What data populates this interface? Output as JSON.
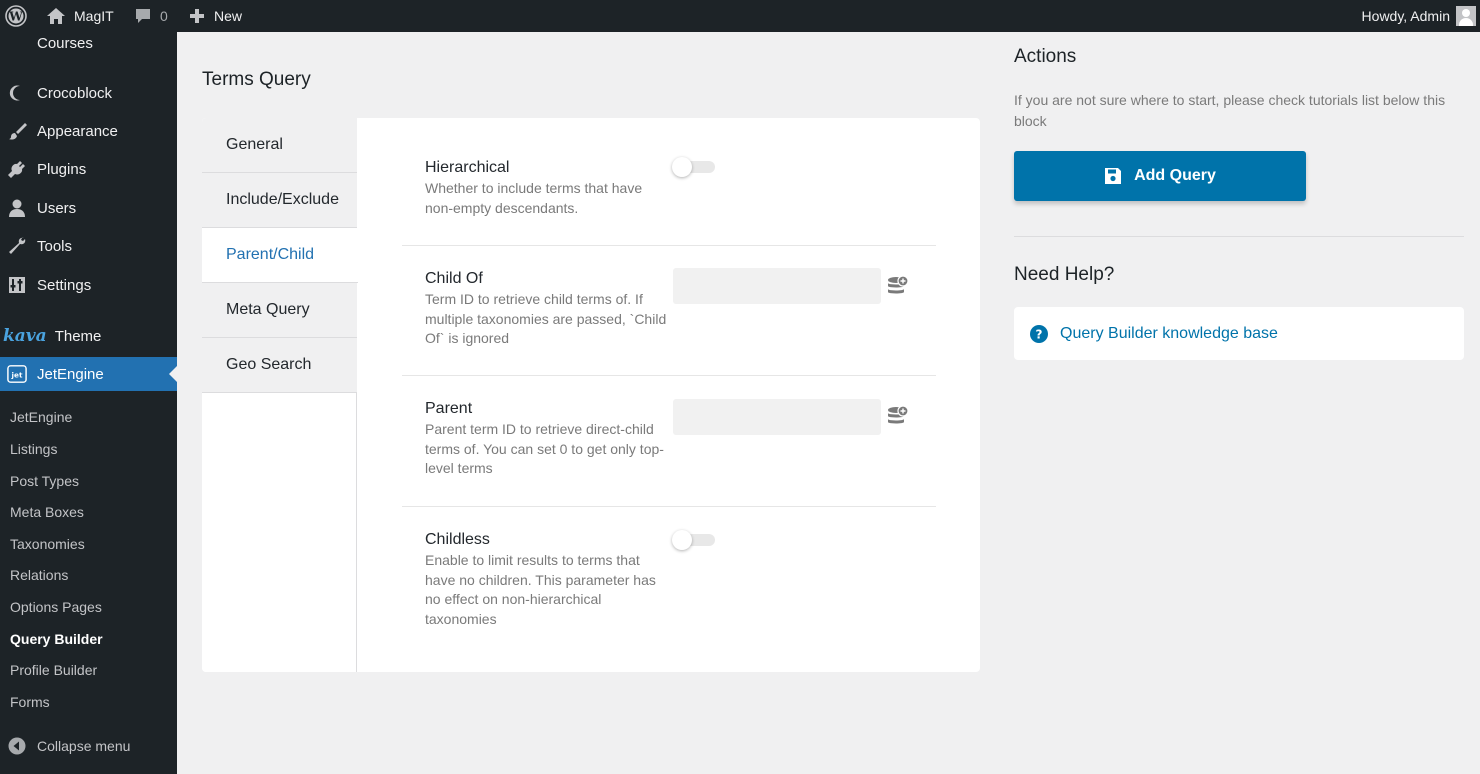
{
  "admin_bar": {
    "site_name": "MagIT",
    "comments_count": "0",
    "new_label": "New",
    "howdy": "Howdy, Admin"
  },
  "sidebar": {
    "menu": [
      {
        "label": "Courses",
        "icon": "courses-icon"
      },
      {
        "label": "Crocoblock",
        "icon": "crocoblock-icon"
      },
      {
        "label": "Appearance",
        "icon": "paintbrush-icon"
      },
      {
        "label": "Plugins",
        "icon": "plugin-icon"
      },
      {
        "label": "Users",
        "icon": "user-icon"
      },
      {
        "label": "Tools",
        "icon": "wrench-icon"
      },
      {
        "label": "Settings",
        "icon": "settings-icon"
      },
      {
        "label": "Theme",
        "icon_text": "kava"
      },
      {
        "label": "JetEngine",
        "icon": "jetengine-icon"
      }
    ],
    "submenu": [
      {
        "label": "JetEngine"
      },
      {
        "label": "Listings"
      },
      {
        "label": "Post Types"
      },
      {
        "label": "Meta Boxes"
      },
      {
        "label": "Taxonomies"
      },
      {
        "label": "Relations"
      },
      {
        "label": "Options Pages"
      },
      {
        "label": "Query Builder",
        "current": true
      },
      {
        "label": "Profile Builder"
      },
      {
        "label": "Forms"
      }
    ],
    "collapse_label": "Collapse menu"
  },
  "main": {
    "title": "Terms Query",
    "tabs": [
      {
        "label": "General"
      },
      {
        "label": "Include/Exclude"
      },
      {
        "label": "Parent/Child",
        "active": true
      },
      {
        "label": "Meta Query"
      },
      {
        "label": "Geo Search"
      }
    ],
    "fields": {
      "hierarchical": {
        "label": "Hierarchical",
        "desc": "Whether to include terms that have non-empty descendants.",
        "enabled": false
      },
      "child_of": {
        "label": "Child Of",
        "desc": "Term ID to retrieve child terms of. If multiple taxonomies are passed, `Child Of` is ignored",
        "value": ""
      },
      "parent": {
        "label": "Parent",
        "desc": "Parent term ID to retrieve direct-child terms of. You can set 0 to get only top-level terms",
        "value": ""
      },
      "childless": {
        "label": "Childless",
        "desc": "Enable to limit results to terms that have no children. This parameter has no effect on non-hierarchical taxonomies",
        "enabled": false
      }
    }
  },
  "actions": {
    "title": "Actions",
    "desc": "If you are not sure where to start, please check tutorials list below this block",
    "add_query_label": "Add Query"
  },
  "help": {
    "title": "Need Help?",
    "link_label": "Query Builder knowledge base"
  },
  "colors": {
    "accent": "#2271b1",
    "button": "#0073aa",
    "sidebar_bg": "#1d2327"
  }
}
